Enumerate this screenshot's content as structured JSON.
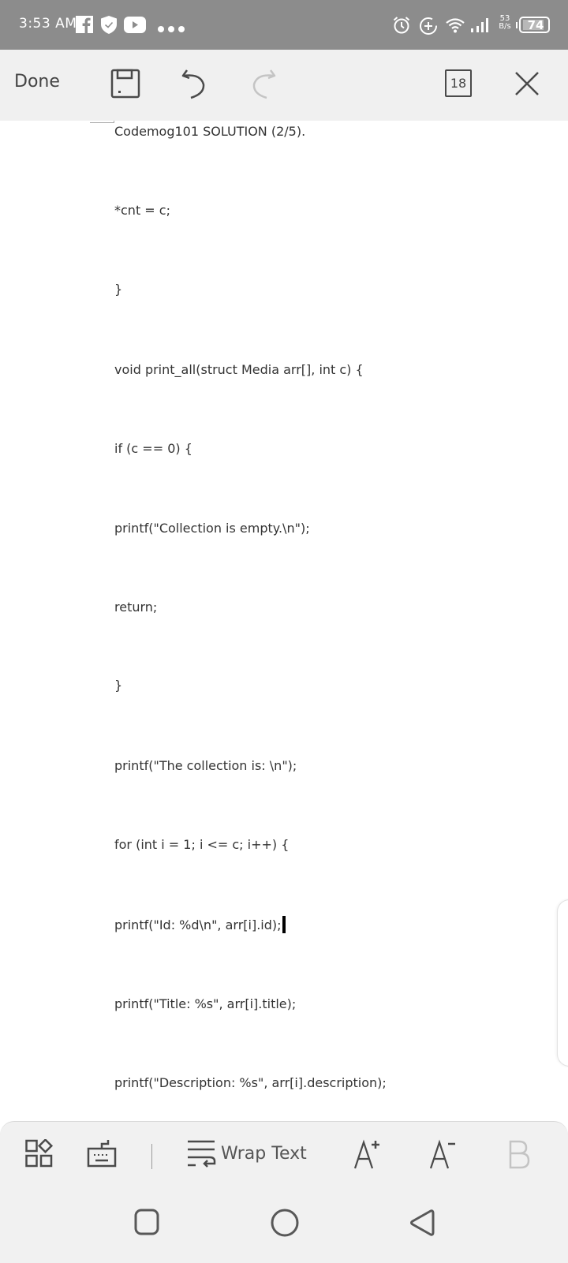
{
  "status_bar": {
    "time": "3:53 AM",
    "notification_icons": [
      "facebook-icon",
      "shield-check-icon",
      "youtube-icon",
      "more-dots-icon"
    ],
    "system_icons": [
      "alarm-icon",
      "data-saver-icon",
      "wifi-icon",
      "signal-icon"
    ],
    "net_speed_value": "53",
    "net_speed_unit": "B/s",
    "battery": "74"
  },
  "toolbar": {
    "done_label": "Done",
    "page_count": "18",
    "icons": [
      "save-icon",
      "undo-icon",
      "redo-icon",
      "page-count-icon",
      "close-icon"
    ]
  },
  "document": {
    "lines": [
      "Codemog101 SOLUTION (2/5).",
      "*cnt = c;",
      "}",
      "void print_all(struct Media arr[], int c) {",
      "if (c == 0) {",
      "printf(\"Collection is empty.\\n\");",
      "return;",
      "}",
      "printf(\"The collection is: \\n\");",
      "for (int i = 1; i <= c; i++) {",
      "printf(\"Id: %d\\n\", arr[i].id);",
      "printf(\"Title: %s\", arr[i].title);",
      "printf(\"Description: %s\", arr[i].description);"
    ],
    "caret_line_index": 10
  },
  "bottom_toolbar": {
    "wrap_text_label": "Wrap Text",
    "icons": [
      "apps-icon",
      "keyboard-icon",
      "wrap-text-icon",
      "font-increase-icon",
      "font-decrease-icon",
      "bold-icon"
    ]
  },
  "nav_bar": {
    "buttons": [
      "recents",
      "home",
      "back"
    ]
  },
  "colors": {
    "status_bar_bg": "#8c8c8c",
    "toolbar_bg": "#f0f0f0",
    "icon_dark": "#4a4a4a",
    "icon_disabled": "#c4c4c4"
  }
}
